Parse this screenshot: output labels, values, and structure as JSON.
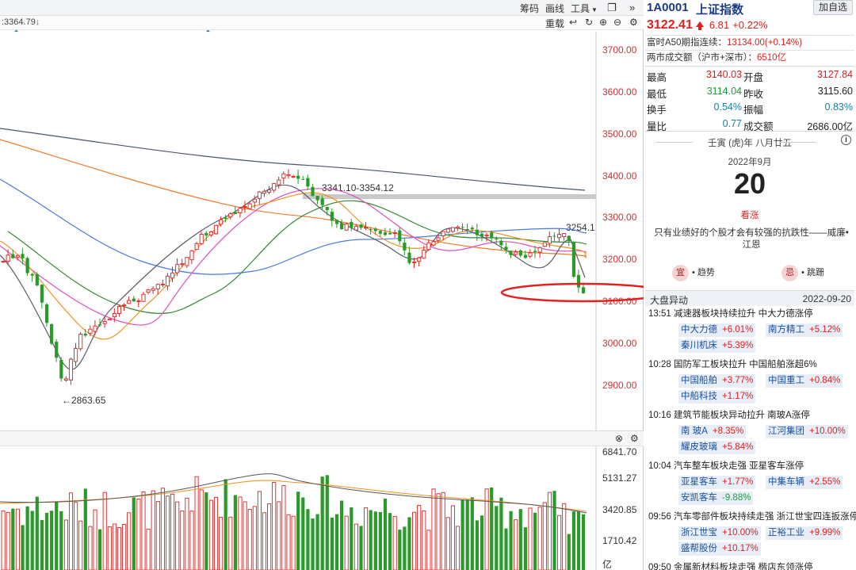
{
  "toolbar": {
    "chouma": "筹码",
    "huaxian": "画线",
    "gongju": "工具",
    "readout": ":3364.79",
    "chongzai": "重载"
  },
  "kline": {
    "y_labels": [
      "3700.00",
      "3600.00",
      "3500.00",
      "3400.00",
      "3300.00",
      "3200.00",
      "3100.00",
      "3000.00",
      "2900.00"
    ],
    "annot_low": "2863.65",
    "annot_band": "3341.10-3354.12",
    "annot_right": "3254.1"
  },
  "volume": {
    "y_labels": [
      "6841.70",
      "5131.27",
      "3420.85",
      "1710.42"
    ],
    "unit": "亿"
  },
  "stock": {
    "code": "1A0001",
    "name": "上证指数",
    "add_fav": "加自选",
    "price": "3122.41",
    "change": "6.81",
    "change_pct": "+0.22%"
  },
  "info": {
    "a50_label": "富时A50期指连续：",
    "a50_value": "13134.00(+0.14%)",
    "turnover_label": "两市成交额（沪市+深市）：",
    "turnover_value": "6510亿"
  },
  "quote": [
    {
      "l1": "最高",
      "v1": "3140.03",
      "c1": "red",
      "l2": "开盘",
      "v2": "3127.84",
      "c2": "red"
    },
    {
      "l1": "最低",
      "v1": "3114.04",
      "c1": "green",
      "l2": "昨收",
      "v2": "3115.60",
      "c2": "black"
    },
    {
      "l1": "换手",
      "v1": "0.54%",
      "c1": "teal",
      "l2": "振幅",
      "v2": "0.83%",
      "c2": "teal"
    },
    {
      "l1": "量比",
      "v1": "0.77",
      "c1": "teal",
      "l2": "成交额",
      "v2": "2686.00亿",
      "c2": "black"
    }
  ],
  "calendar": {
    "lunar": "壬寅 (虎)年 八月廿五",
    "month": "2022年9月",
    "day": "20",
    "tag": "看涨",
    "quote": "只有业绩好的个股才会有较强的抗跌性——威廉•江恩",
    "btn1_icon": "宜",
    "btn1_label": "趋势",
    "btn2_icon": "忌",
    "btn2_label": "跳跚"
  },
  "movers": {
    "title": "大盘异动",
    "date": "2022-09-20",
    "events": [
      {
        "title": "13:51  减速器板块持续拉升 中大力德涨停",
        "stocks": [
          {
            "n": "中大力德",
            "p": "+6.01%",
            "c": "red"
          },
          {
            "n": "南方精工",
            "p": "+5.12%",
            "c": "red"
          },
          {
            "n": "秦川机床",
            "p": "+5.39%",
            "c": "red"
          }
        ]
      },
      {
        "title": "10:28  国防军工板块拉升 中国船舶涨超6%",
        "stocks": [
          {
            "n": "中国船舶",
            "p": "+3.77%",
            "c": "red"
          },
          {
            "n": "中国重工",
            "p": "+0.84%",
            "c": "red"
          },
          {
            "n": "中船科技",
            "p": "+1.17%",
            "c": "red"
          }
        ]
      },
      {
        "title": "10:16  建筑节能板块异动拉升 南玻A涨停",
        "stocks": [
          {
            "n": "南 玻A",
            "p": "+8.35%",
            "c": "red"
          },
          {
            "n": "江河集团",
            "p": "+10.00%",
            "c": "red"
          },
          {
            "n": "耀皮玻璃",
            "p": "+5.84%",
            "c": "red"
          }
        ]
      },
      {
        "title": "10:04  汽车整车板块走强 亚星客车涨停",
        "stocks": [
          {
            "n": "亚星客车",
            "p": "+1.77%",
            "c": "red"
          },
          {
            "n": "中集车辆",
            "p": "+2.55%",
            "c": "red"
          },
          {
            "n": "安凯客车",
            "p": "-9.88%",
            "c": "green"
          }
        ]
      },
      {
        "title": "09:56  汽车零部件板块持续走强 浙江世宝四连扳涨停",
        "stocks": [
          {
            "n": "浙江世宝",
            "p": "+10.00%",
            "c": "red"
          },
          {
            "n": "正裕工业",
            "p": "+9.99%",
            "c": "red"
          },
          {
            "n": "盛帮股份",
            "p": "+10.17%",
            "c": "red"
          }
        ]
      },
      {
        "title": "09:50  金属新材料板块走强 楷店东领涨停",
        "stocks": []
      }
    ]
  }
}
